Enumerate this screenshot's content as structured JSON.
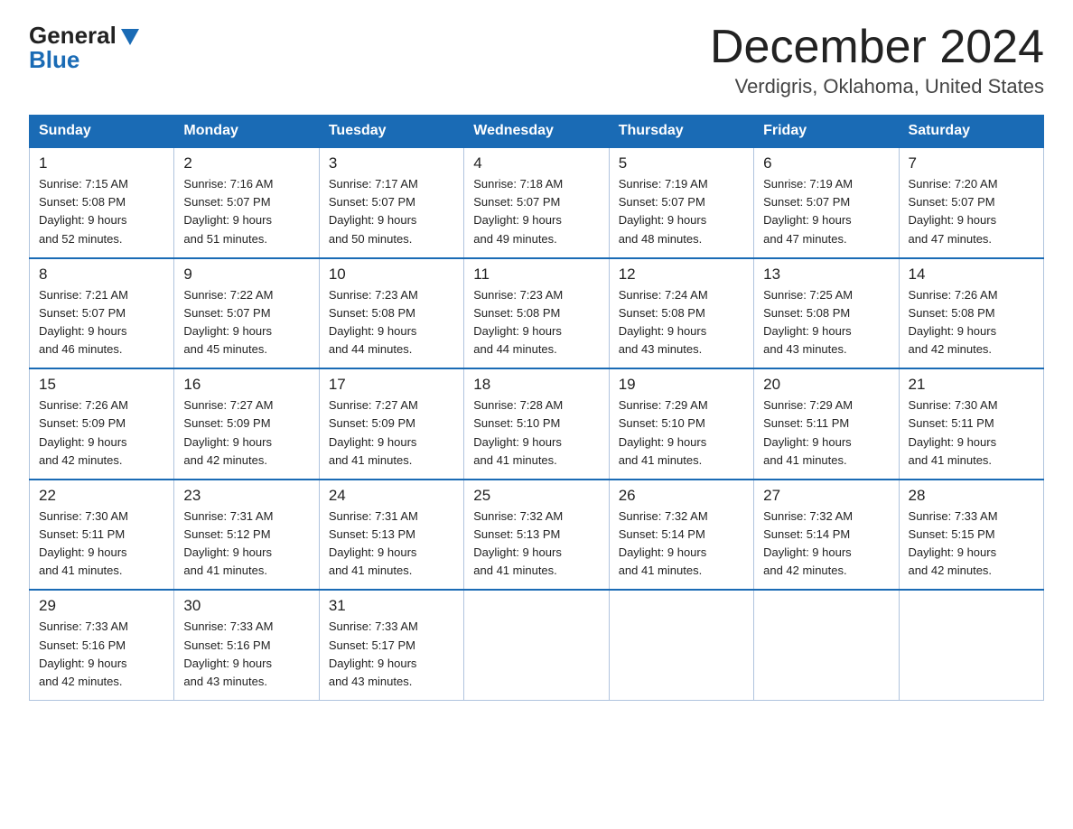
{
  "header": {
    "logo_line1": "General",
    "logo_line2": "Blue",
    "title": "December 2024",
    "subtitle": "Verdigris, Oklahoma, United States"
  },
  "weekdays": [
    "Sunday",
    "Monday",
    "Tuesday",
    "Wednesday",
    "Thursday",
    "Friday",
    "Saturday"
  ],
  "weeks": [
    [
      {
        "day": "1",
        "sunrise": "7:15 AM",
        "sunset": "5:08 PM",
        "daylight": "9 hours and 52 minutes."
      },
      {
        "day": "2",
        "sunrise": "7:16 AM",
        "sunset": "5:07 PM",
        "daylight": "9 hours and 51 minutes."
      },
      {
        "day": "3",
        "sunrise": "7:17 AM",
        "sunset": "5:07 PM",
        "daylight": "9 hours and 50 minutes."
      },
      {
        "day": "4",
        "sunrise": "7:18 AM",
        "sunset": "5:07 PM",
        "daylight": "9 hours and 49 minutes."
      },
      {
        "day": "5",
        "sunrise": "7:19 AM",
        "sunset": "5:07 PM",
        "daylight": "9 hours and 48 minutes."
      },
      {
        "day": "6",
        "sunrise": "7:19 AM",
        "sunset": "5:07 PM",
        "daylight": "9 hours and 47 minutes."
      },
      {
        "day": "7",
        "sunrise": "7:20 AM",
        "sunset": "5:07 PM",
        "daylight": "9 hours and 47 minutes."
      }
    ],
    [
      {
        "day": "8",
        "sunrise": "7:21 AM",
        "sunset": "5:07 PM",
        "daylight": "9 hours and 46 minutes."
      },
      {
        "day": "9",
        "sunrise": "7:22 AM",
        "sunset": "5:07 PM",
        "daylight": "9 hours and 45 minutes."
      },
      {
        "day": "10",
        "sunrise": "7:23 AM",
        "sunset": "5:08 PM",
        "daylight": "9 hours and 44 minutes."
      },
      {
        "day": "11",
        "sunrise": "7:23 AM",
        "sunset": "5:08 PM",
        "daylight": "9 hours and 44 minutes."
      },
      {
        "day": "12",
        "sunrise": "7:24 AM",
        "sunset": "5:08 PM",
        "daylight": "9 hours and 43 minutes."
      },
      {
        "day": "13",
        "sunrise": "7:25 AM",
        "sunset": "5:08 PM",
        "daylight": "9 hours and 43 minutes."
      },
      {
        "day": "14",
        "sunrise": "7:26 AM",
        "sunset": "5:08 PM",
        "daylight": "9 hours and 42 minutes."
      }
    ],
    [
      {
        "day": "15",
        "sunrise": "7:26 AM",
        "sunset": "5:09 PM",
        "daylight": "9 hours and 42 minutes."
      },
      {
        "day": "16",
        "sunrise": "7:27 AM",
        "sunset": "5:09 PM",
        "daylight": "9 hours and 42 minutes."
      },
      {
        "day": "17",
        "sunrise": "7:27 AM",
        "sunset": "5:09 PM",
        "daylight": "9 hours and 41 minutes."
      },
      {
        "day": "18",
        "sunrise": "7:28 AM",
        "sunset": "5:10 PM",
        "daylight": "9 hours and 41 minutes."
      },
      {
        "day": "19",
        "sunrise": "7:29 AM",
        "sunset": "5:10 PM",
        "daylight": "9 hours and 41 minutes."
      },
      {
        "day": "20",
        "sunrise": "7:29 AM",
        "sunset": "5:11 PM",
        "daylight": "9 hours and 41 minutes."
      },
      {
        "day": "21",
        "sunrise": "7:30 AM",
        "sunset": "5:11 PM",
        "daylight": "9 hours and 41 minutes."
      }
    ],
    [
      {
        "day": "22",
        "sunrise": "7:30 AM",
        "sunset": "5:11 PM",
        "daylight": "9 hours and 41 minutes."
      },
      {
        "day": "23",
        "sunrise": "7:31 AM",
        "sunset": "5:12 PM",
        "daylight": "9 hours and 41 minutes."
      },
      {
        "day": "24",
        "sunrise": "7:31 AM",
        "sunset": "5:13 PM",
        "daylight": "9 hours and 41 minutes."
      },
      {
        "day": "25",
        "sunrise": "7:32 AM",
        "sunset": "5:13 PM",
        "daylight": "9 hours and 41 minutes."
      },
      {
        "day": "26",
        "sunrise": "7:32 AM",
        "sunset": "5:14 PM",
        "daylight": "9 hours and 41 minutes."
      },
      {
        "day": "27",
        "sunrise": "7:32 AM",
        "sunset": "5:14 PM",
        "daylight": "9 hours and 42 minutes."
      },
      {
        "day": "28",
        "sunrise": "7:33 AM",
        "sunset": "5:15 PM",
        "daylight": "9 hours and 42 minutes."
      }
    ],
    [
      {
        "day": "29",
        "sunrise": "7:33 AM",
        "sunset": "5:16 PM",
        "daylight": "9 hours and 42 minutes."
      },
      {
        "day": "30",
        "sunrise": "7:33 AM",
        "sunset": "5:16 PM",
        "daylight": "9 hours and 43 minutes."
      },
      {
        "day": "31",
        "sunrise": "7:33 AM",
        "sunset": "5:17 PM",
        "daylight": "9 hours and 43 minutes."
      },
      null,
      null,
      null,
      null
    ]
  ],
  "colors": {
    "header_bg": "#1a6bb5",
    "border": "#b0c4de",
    "row_border": "#1a6bb5"
  }
}
